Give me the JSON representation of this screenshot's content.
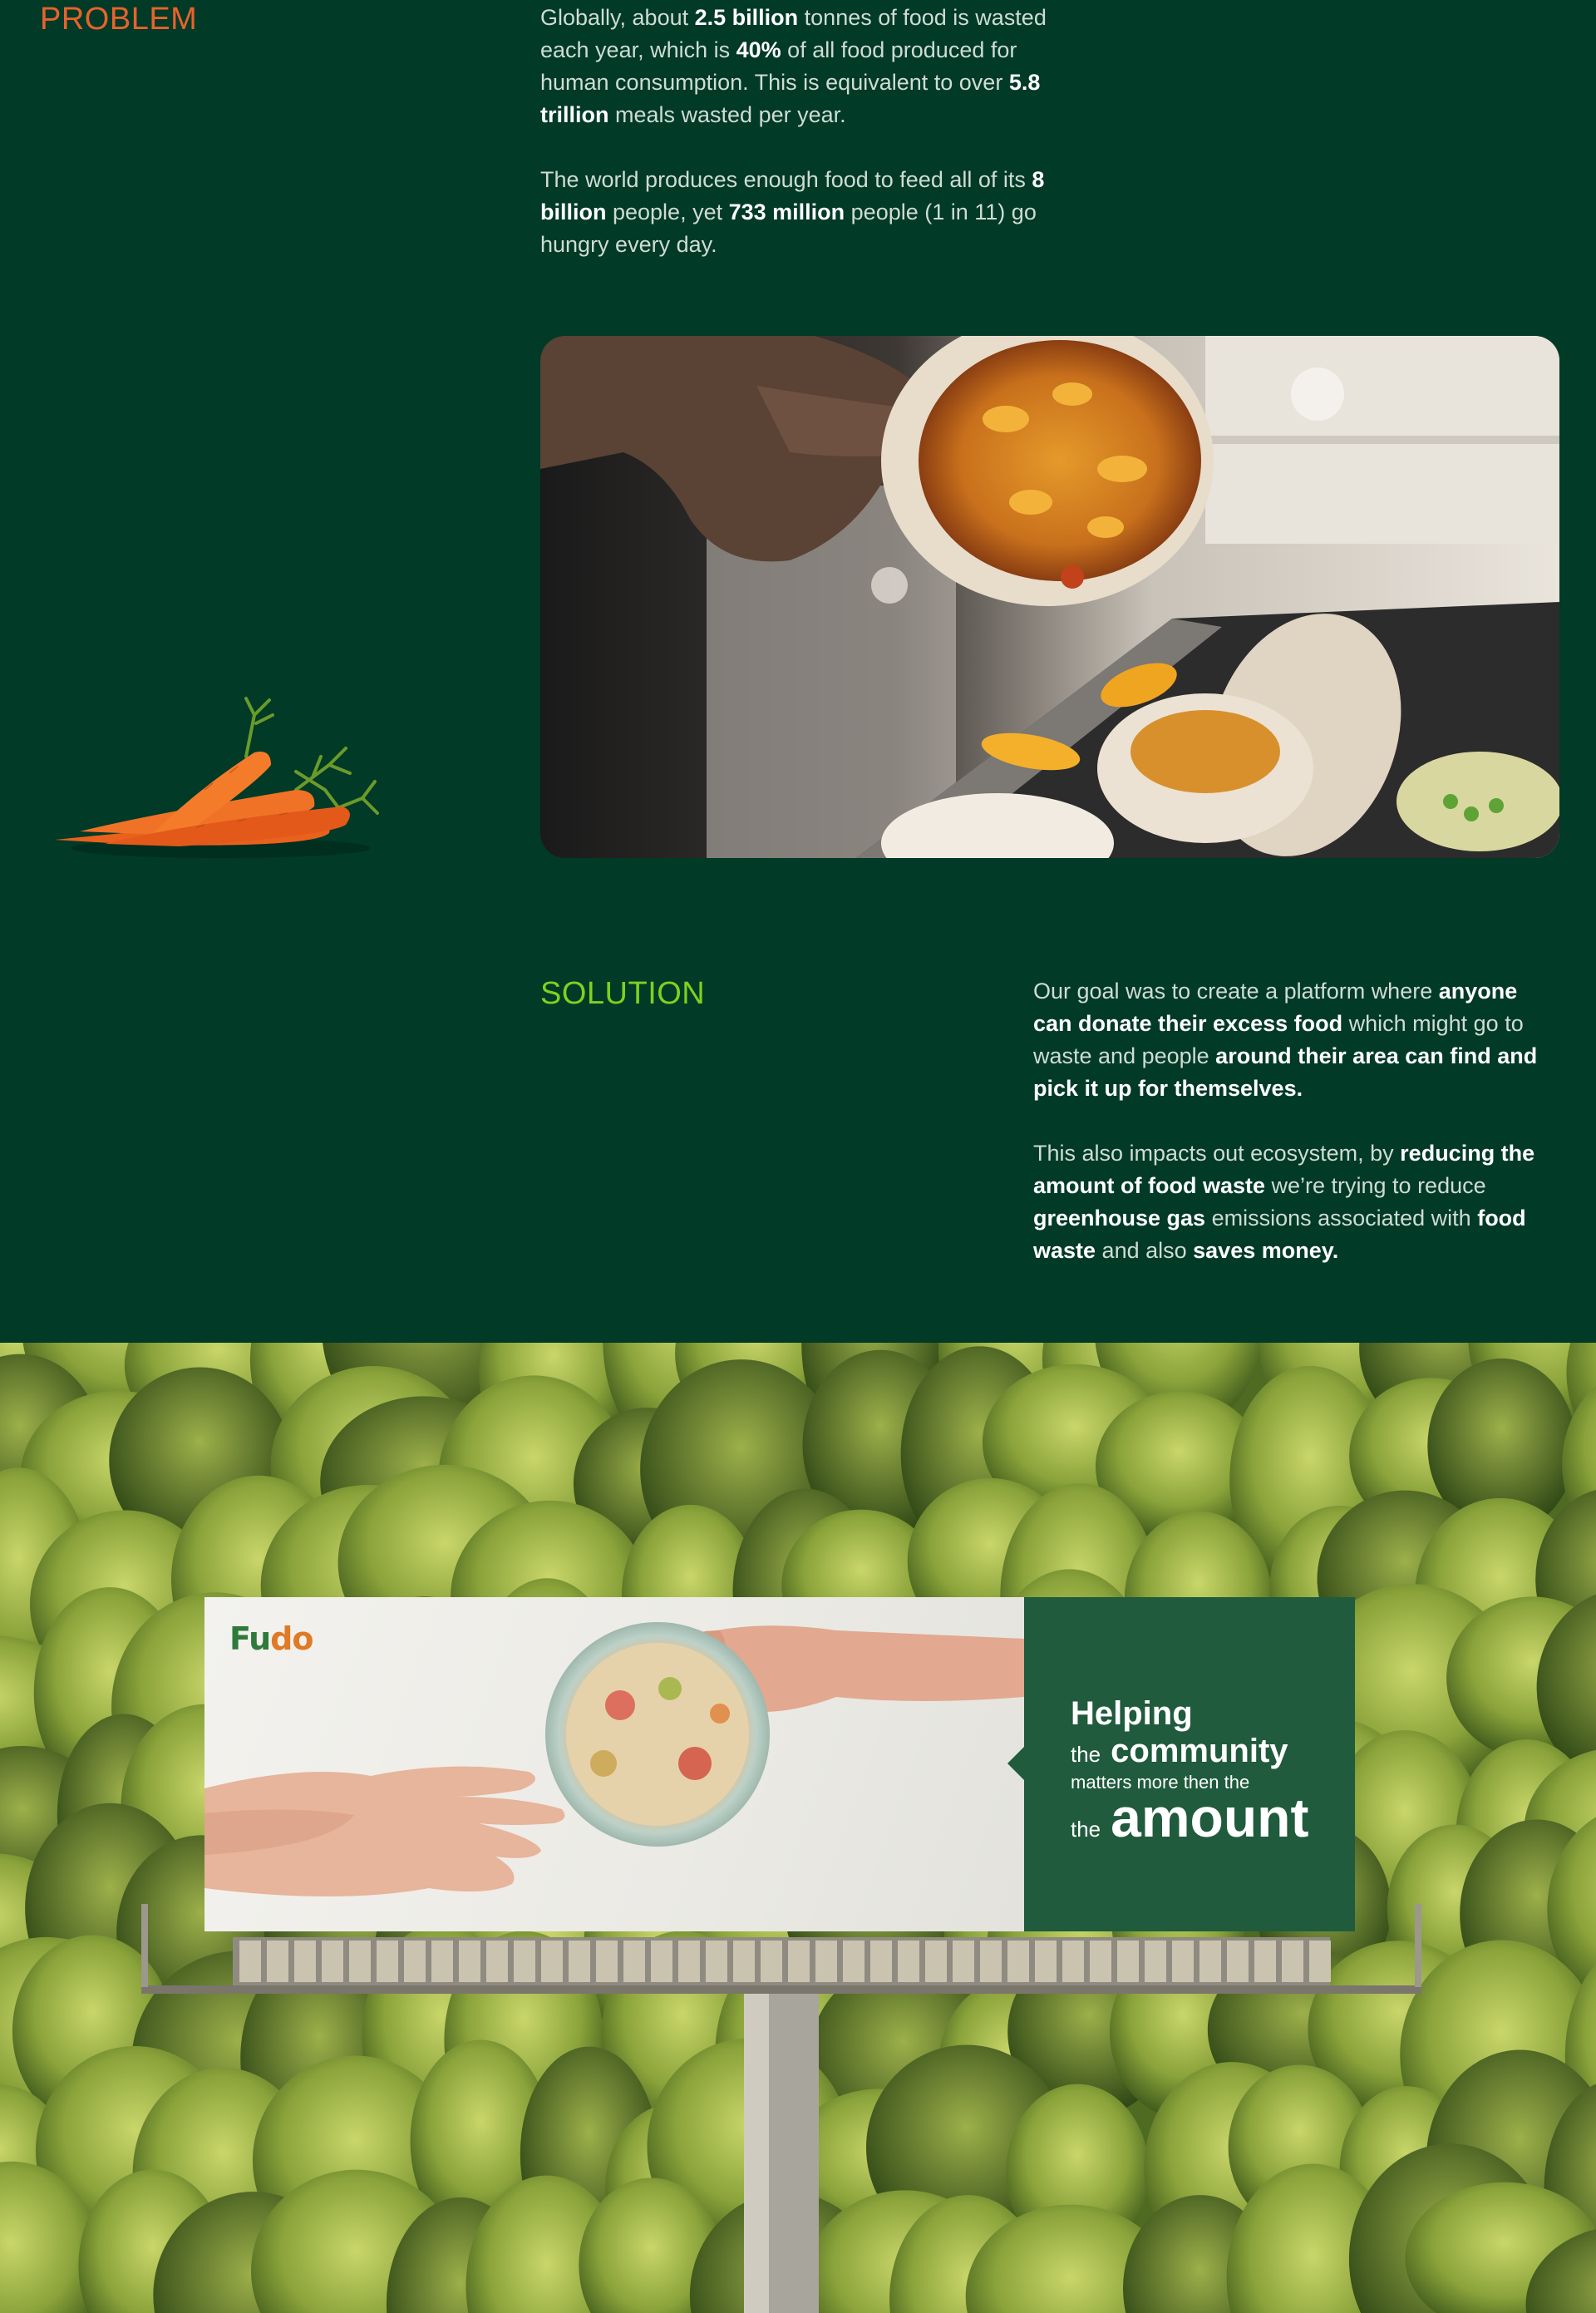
{
  "problem": {
    "heading": "PROBLEM",
    "para1": [
      {
        "t": "Globally, about ",
        "b": false
      },
      {
        "t": "2.5 billion",
        "b": true
      },
      {
        "t": " tonnes of food is wasted each year, which is ",
        "b": false
      },
      {
        "t": "40%",
        "b": true
      },
      {
        "t": " of all food produced for human consumption. This is equivalent to over ",
        "b": false
      },
      {
        "t": "5.8 trillion",
        "b": true
      },
      {
        "t": " meals wasted per year.",
        "b": false
      }
    ],
    "para2": [
      {
        "t": "The world produces enough food to feed all of its ",
        "b": false
      },
      {
        "t": "8 billion",
        "b": true
      },
      {
        "t": " people, yet ",
        "b": false
      },
      {
        "t": "733 million",
        "b": true
      },
      {
        "t": " people",
        "b": false
      },
      {
        "t": " (1 in 11) go hungry every day.",
        "b": false
      }
    ]
  },
  "solution": {
    "heading": "SOLUTION",
    "para1": [
      {
        "t": "Our goal was to create a platform where ",
        "b": false
      },
      {
        "t": "anyone can donate their excess food",
        "b": true
      },
      {
        "t": " which might go to waste and people ",
        "b": false
      },
      {
        "t": "around their area can find and pick it up for themselves.",
        "b": true
      }
    ],
    "para2": [
      {
        "t": "This also impacts out ecosystem, by ",
        "b": false
      },
      {
        "t": "reducing the amount of food waste",
        "b": true
      },
      {
        "t": " we’re trying to reduce ",
        "b": false
      },
      {
        "t": "greenhouse gas",
        "b": true
      },
      {
        "t": " emissions associated with ",
        "b": false
      },
      {
        "t": "food waste",
        "b": true
      },
      {
        "t": " and also ",
        "b": false
      },
      {
        "t": "saves money.",
        "b": true
      }
    ]
  },
  "billboard": {
    "logo_part1": "Fu",
    "logo_part2": "do",
    "line1": "Helping",
    "line2_small": "the",
    "line2_big": "community",
    "line3": "matters more then the",
    "line4_small": "the",
    "line4_big": "amount"
  },
  "colors": {
    "background": "#013a27",
    "problem_accent": "#e8622c",
    "solution_accent": "#7fd11f",
    "billboard_panel": "#1f5b3c"
  },
  "icons": {
    "carrot": "carrot-illustration",
    "waste_photo": "food-waste-photo",
    "billboard_photo": "hand-bowl-photo"
  }
}
